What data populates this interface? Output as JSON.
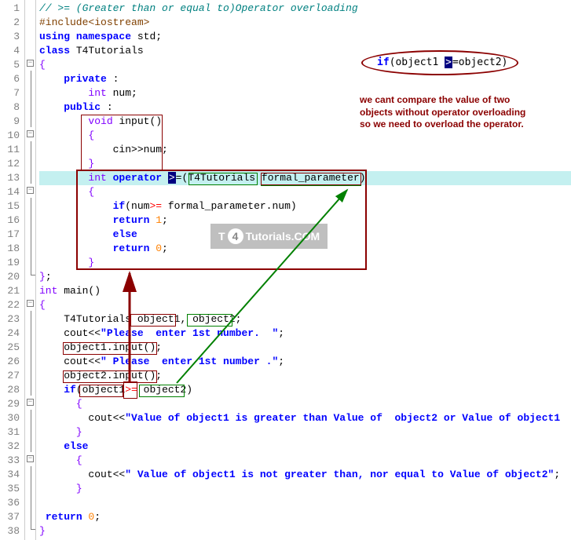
{
  "lines": {
    "l1_comment": "// >= (Greater than or equal to)Operator overloading",
    "l2_preproc": "#include<iostream>",
    "l3_using": "using",
    "l3_namespace": "namespace",
    "l3_std": " std;",
    "l4_class": "class",
    "l4_name": " T4Tutorials",
    "l6_private": "private",
    "l6_colon": " :",
    "l7_int": "int",
    "l7_num": " num;",
    "l8_public": "public",
    "l8_colon": " :",
    "l9_void": "void",
    "l9_input": " input()",
    "l11_cin": "cin>>num;",
    "l13_int": "int",
    "l13_operator": " operator ",
    "l13_op": ">",
    "l13_eq": "=(",
    "l13_type": "T4Tutorials ",
    "l13_param": "formal_parameter",
    "l13_close": ")",
    "l15_if": "if",
    "l15_cond1": "(num",
    "l15_op": ">=",
    "l15_cond2": " formal_parameter.num)",
    "l16_return": "return",
    "l16_val": " 1",
    "l17_else": "else",
    "l18_return": "return",
    "l18_val": " 0",
    "l21_int": "int",
    "l21_main": " main()",
    "l23_type": "T4Tutorials ",
    "l23_obj1": "object1",
    "l23_comma": ", ",
    "l23_obj2": "object2",
    "l23_semi": ";",
    "l24_cout": "cout<<",
    "l24_str": "\"Please  enter 1st number.  \"",
    "l24_semi": ";",
    "l25_obj": "object1",
    "l25_dot": ".",
    "l25_input": "input()",
    "l25_semi": ";",
    "l26_cout": "cout<<",
    "l26_str": "\" Please  enter 1st number .\"",
    "l26_semi": ";",
    "l27_obj": "object2",
    "l27_dot": ".",
    "l27_input": "input()",
    "l27_semi": ";",
    "l28_if": "if",
    "l28_open": "(",
    "l28_obj1": "object1",
    "l28_op": ">=",
    "l28_obj2": " object2",
    "l28_close": ")",
    "l30_cout": "cout<<",
    "l30_str": "\"Value of object1 is greater than Value of  object2 or Value of object1",
    "l32_else": "else",
    "l34_cout": "cout<<",
    "l34_str": "\" Value of object1 is not greater than, nor equal to Value of object2\"",
    "l34_semi": ";",
    "l37_return": "return",
    "l37_val": " 0",
    "l37_semi": ";"
  },
  "annotations": {
    "ellipse_text_if": "if",
    "ellipse_text_open": "(",
    "ellipse_text_obj1": "object1 ",
    "ellipse_text_op": ">",
    "ellipse_text_eq": "=",
    "ellipse_text_obj2": "object2",
    "ellipse_text_close": ")",
    "note_line1": "we cant compare the value of two",
    "note_line2": "objects without operator overloading",
    "note_line3": "so we need to overload the operator.",
    "watermark_t": "T",
    "watermark_4": "4",
    "watermark_rest": "Tutorials.COM"
  },
  "line_numbers": [
    "1",
    "2",
    "3",
    "4",
    "5",
    "6",
    "7",
    "8",
    "9",
    "10",
    "11",
    "12",
    "13",
    "14",
    "15",
    "16",
    "17",
    "18",
    "19",
    "20",
    "21",
    "22",
    "23",
    "24",
    "25",
    "26",
    "27",
    "28",
    "29",
    "30",
    "31",
    "32",
    "33",
    "34",
    "35",
    "36",
    "37",
    "38"
  ]
}
